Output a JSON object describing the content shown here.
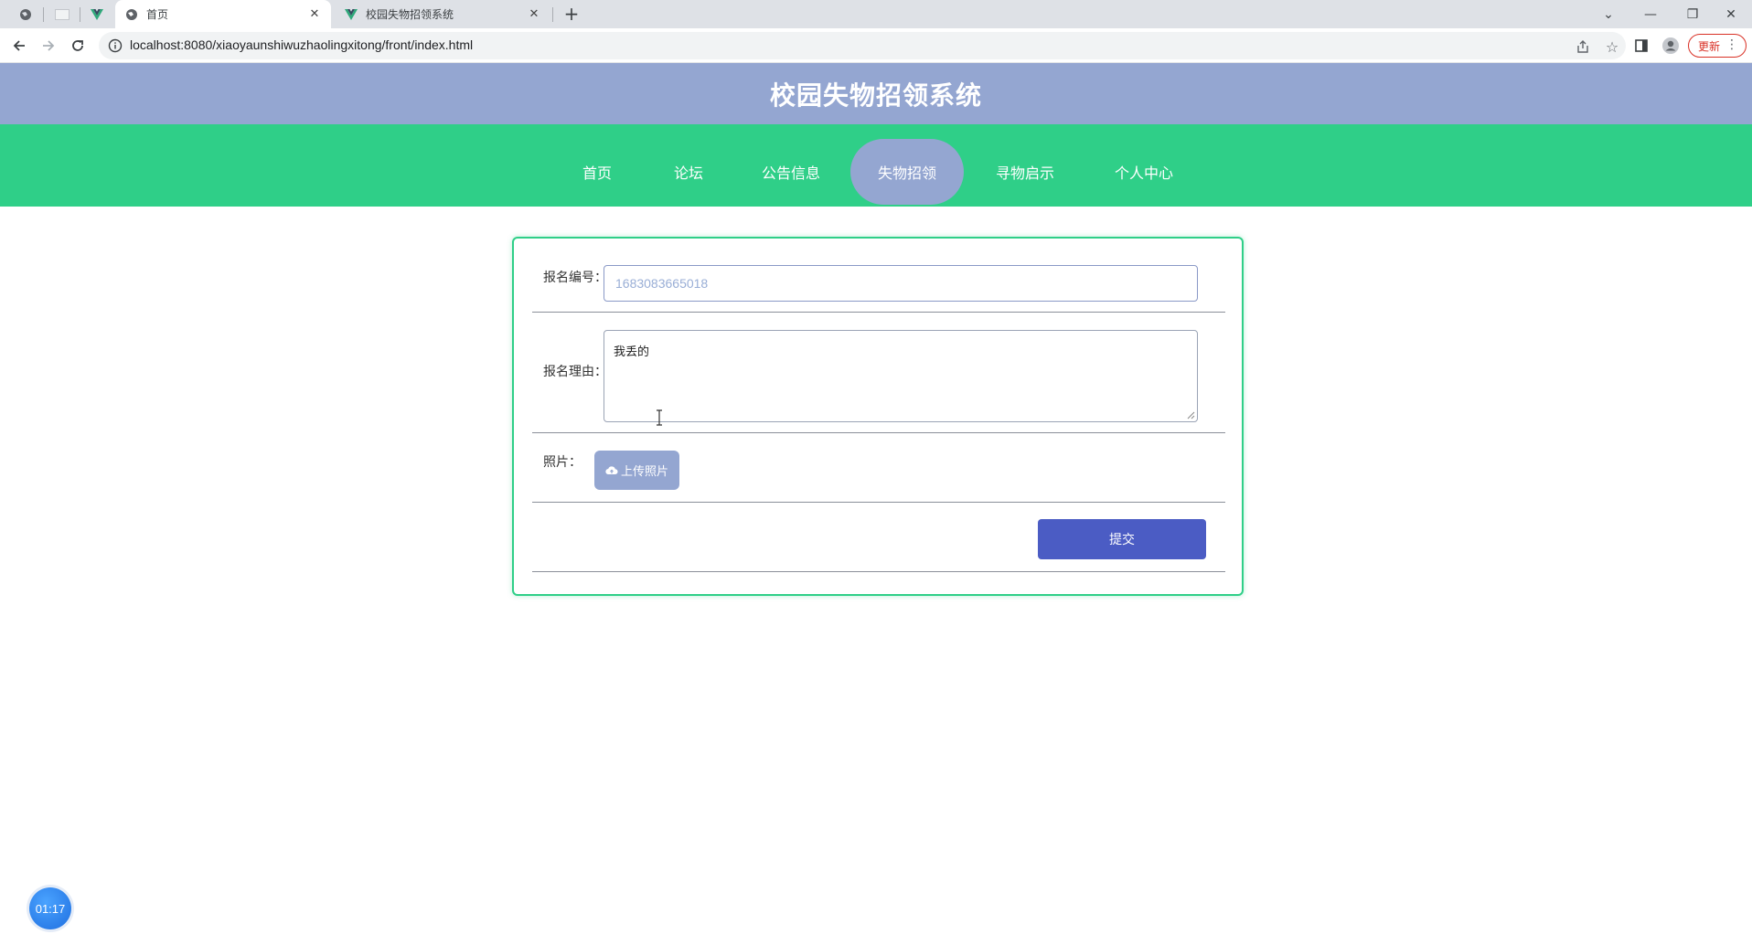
{
  "browser": {
    "tabs": [
      {
        "title": "首页",
        "active": true,
        "icon": "globe-icon"
      },
      {
        "title": "校园失物招领系统",
        "active": false,
        "icon": "vue-icon"
      }
    ],
    "url": "localhost:8080/xiaoyaunshiwuzhaolingxitong/front/index.html",
    "update_label": "更新"
  },
  "site": {
    "title": "校园失物招领系统",
    "nav": [
      "首页",
      "论坛",
      "公告信息",
      "失物招领",
      "寻物启示",
      "个人中心"
    ],
    "active_nav_index": 3
  },
  "form": {
    "signup_no": {
      "label": "报名编号：",
      "value": "1683083665018"
    },
    "reason": {
      "label": "报名理由：",
      "value": "我丢的"
    },
    "photo": {
      "label": "照片：",
      "button": "上传照片"
    },
    "submit": "提交"
  },
  "timer": "01:17",
  "colors": {
    "header": "#94a6d1",
    "nav": "#2fcf88",
    "submit": "#4b5cc4"
  }
}
